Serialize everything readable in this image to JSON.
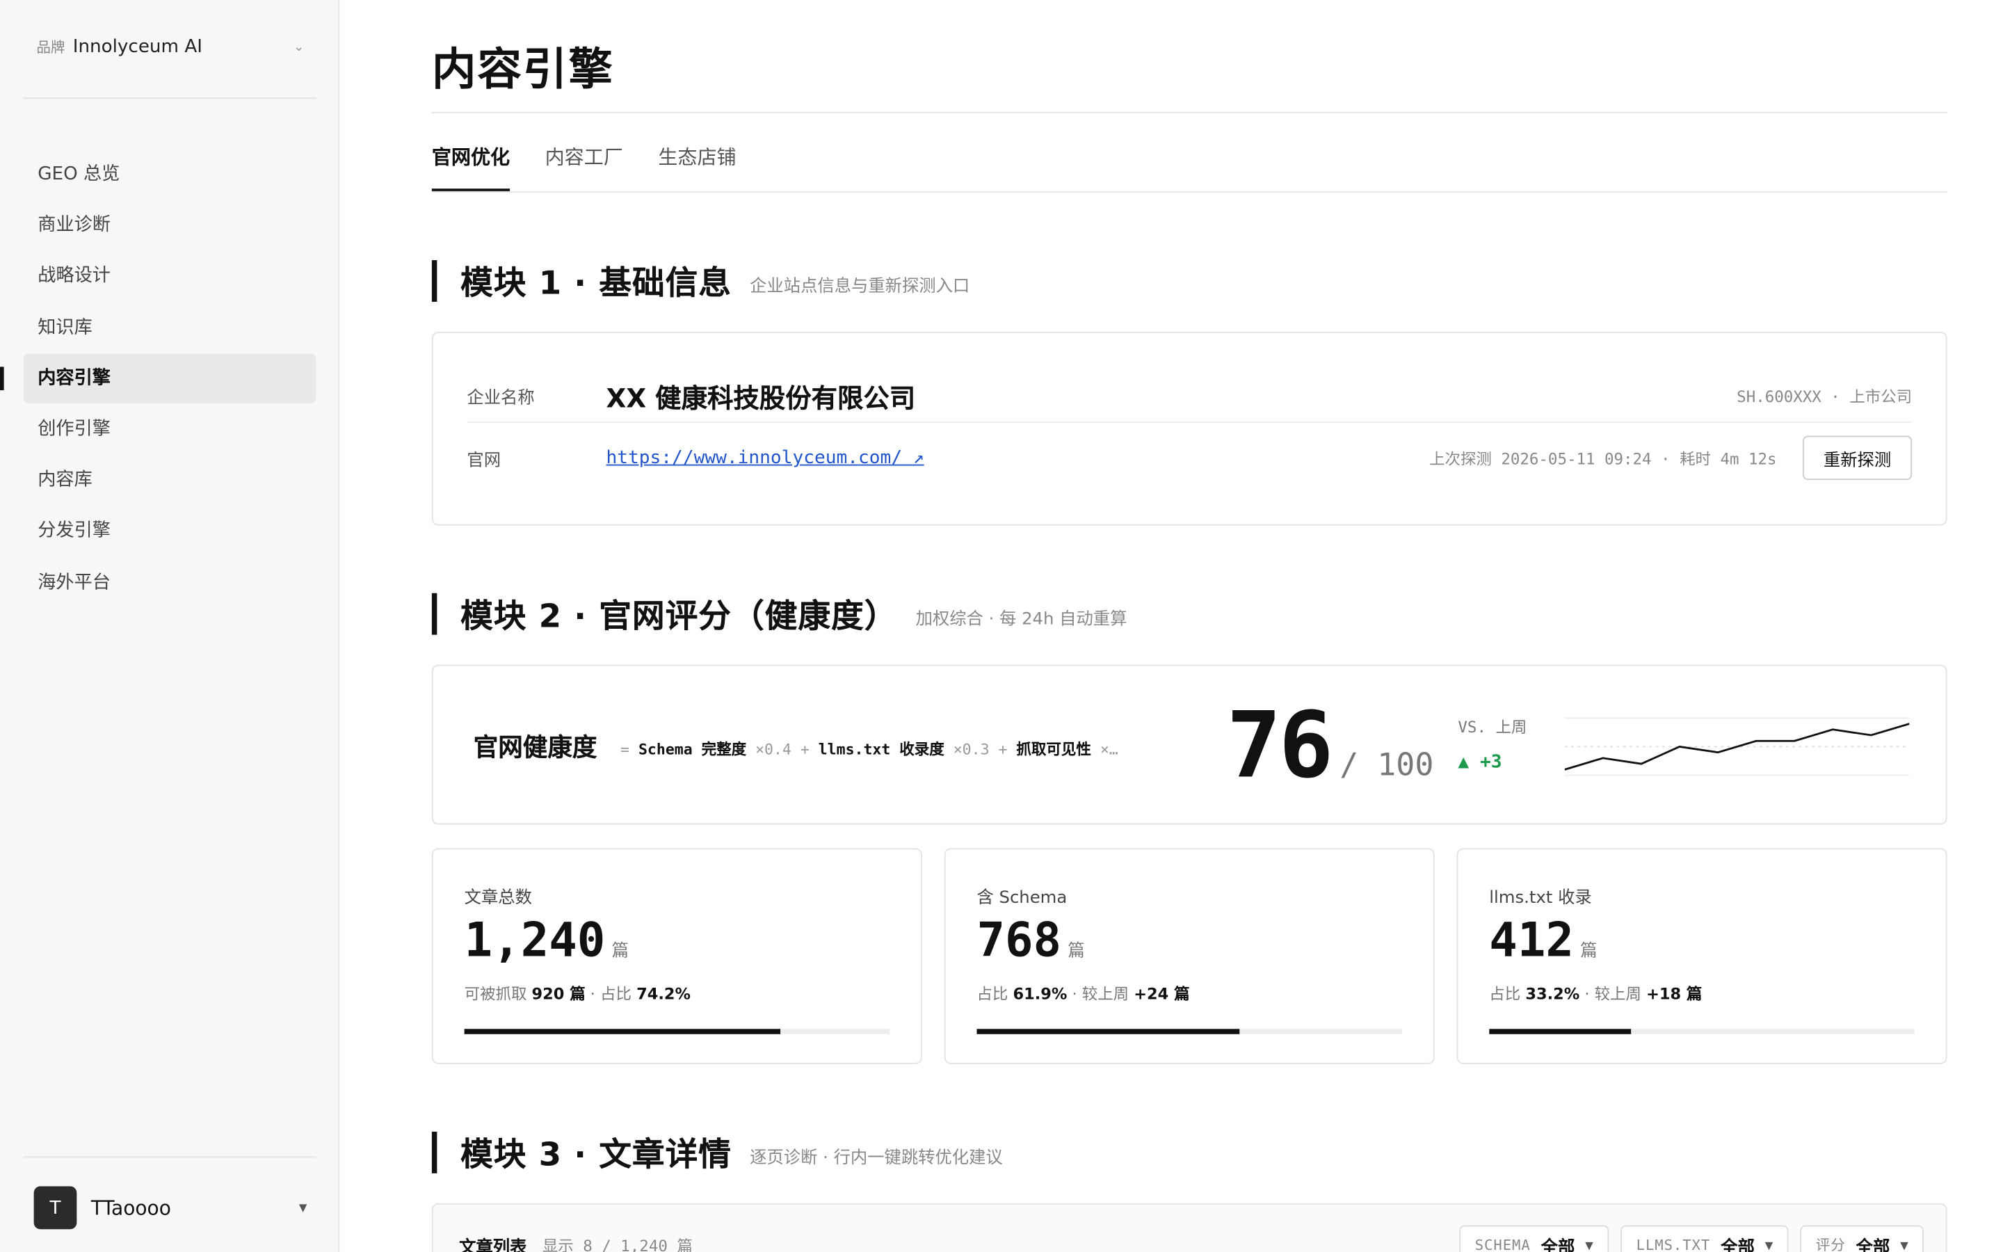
{
  "brand": {
    "tag": "品牌",
    "name": "Innolyceum AI"
  },
  "nav": [
    "GEO 总览",
    "商业诊断",
    "战略设计",
    "知识库",
    "内容引擎",
    "创作引擎",
    "内容库",
    "分发引擎",
    "海外平台"
  ],
  "nav_active": "内容引擎",
  "user": {
    "initial": "T",
    "name": "TTaoooo"
  },
  "page": {
    "title": "内容引擎"
  },
  "tabs": [
    "官网优化",
    "内容工厂",
    "生态店铺"
  ],
  "module1": {
    "title": "模块 1 · 基础信息",
    "subtitle": "企业站点信息与重新探测入口",
    "company_label": "企业名称",
    "company_name": "XX 健康科技股份有限公司",
    "ticker": "SH.600XXX · 上市公司",
    "site_label": "官网",
    "site_url": "https://www.innolyceum.com/ ↗",
    "probe_info": "上次探测 2026-05-11 09:24 · 耗时 4m 12s",
    "reprobe_label": "重新探测"
  },
  "module2": {
    "title": "模块 2 · 官网评分（健康度）",
    "subtitle": "加权综合 · 每 24h 自动重算",
    "health_title": "官网健康度",
    "formula": {
      "eq": "= ",
      "t1": "Schema 完整度",
      "w1": " ×0.4 + ",
      "t2": "llms.txt 收录度",
      "w2": " ×0.3 + ",
      "t3": "抓取可见性",
      "w3": " ×…"
    },
    "score": "76",
    "score_max": "/ 100",
    "vs_label": "VS. 上周",
    "delta": "▲ +3",
    "trend": [
      68,
      70,
      69,
      72,
      71,
      73,
      73,
      75,
      74,
      76
    ],
    "stats": [
      {
        "label": "文章总数",
        "value": "1,240",
        "unit": "篇",
        "meta": [
          [
            "可被抓取 ",
            "920 篇"
          ],
          [
            " · 占比 ",
            "74.2%"
          ]
        ],
        "progress": 0.742
      },
      {
        "label": "含 Schema",
        "value": "768",
        "unit": "篇",
        "meta": [
          [
            "占比 ",
            "61.9%"
          ],
          [
            " · 较上周 ",
            "+24 篇"
          ]
        ],
        "progress": 0.619
      },
      {
        "label": "llms.txt 收录",
        "value": "412",
        "unit": "篇",
        "meta": [
          [
            "占比 ",
            "33.2%"
          ],
          [
            " · 较上周 ",
            "+18 篇"
          ]
        ],
        "progress": 0.332
      }
    ]
  },
  "module3": {
    "title": "模块 3 · 文章详情",
    "subtitle": "逐页诊断 · 行内一键跳转优化建议",
    "list_title": "文章列表",
    "list_count": "显示 8 / 1,240 篇",
    "filters": [
      {
        "key": "SCHEMA",
        "value": "全部"
      },
      {
        "key": "LLMS.TXT",
        "value": "全部"
      },
      {
        "key": "评分",
        "value": "全部"
      }
    ]
  }
}
